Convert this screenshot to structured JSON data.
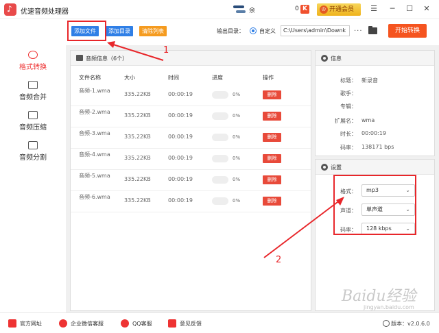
{
  "app": {
    "title": "优速音频处理器",
    "user": "余",
    "coins": "0",
    "coin_badge": "K",
    "vip_label": "开通会员",
    "vip_crown": "♔"
  },
  "window_controls": {
    "menu": "☰",
    "minimize": "─",
    "maximize": "☐",
    "close": "✕"
  },
  "toolbar": {
    "add_file": "添加文件",
    "add_dir": "添加目录",
    "clear_list": "清除列表",
    "output_label": "输出目录：",
    "custom_label": "自定义",
    "path_value": "C:\\Users\\admin\\Downk",
    "more": "···",
    "start": "开始转换"
  },
  "sidebar": {
    "items": [
      {
        "label": "格式转换",
        "icon": "format-convert-icon",
        "active": true
      },
      {
        "label": "音频合并",
        "icon": "merge-icon",
        "active": false
      },
      {
        "label": "音频压缩",
        "icon": "compress-icon",
        "active": false
      },
      {
        "label": "音频分割",
        "icon": "split-icon",
        "active": false
      }
    ]
  },
  "file_panel": {
    "title": "音频信息（6个）",
    "columns": [
      "文件名称",
      "大小",
      "时间",
      "进度",
      "操作"
    ],
    "rows": [
      {
        "name": "音频-1.wma",
        "size": "335.22KB",
        "time": "00:00:19",
        "progress": "0%",
        "action": "删除"
      },
      {
        "name": "音频-2.wma",
        "size": "335.22KB",
        "time": "00:00:19",
        "progress": "0%",
        "action": "删除"
      },
      {
        "name": "音频-3.wma",
        "size": "335.22KB",
        "time": "00:00:19",
        "progress": "0%",
        "action": "删除"
      },
      {
        "name": "音频-4.wma",
        "size": "335.22KB",
        "time": "00:00:19",
        "progress": "0%",
        "action": "删除"
      },
      {
        "name": "音频-5.wma",
        "size": "335.22KB",
        "time": "00:00:19",
        "progress": "0%",
        "action": "删除"
      },
      {
        "name": "音频-6.wma",
        "size": "335.22KB",
        "time": "00:00:19",
        "progress": "0%",
        "action": "删除"
      }
    ]
  },
  "info_panel": {
    "title": "信息",
    "fields": [
      {
        "key": "标题：",
        "value": "新录音"
      },
      {
        "key": "歌手：",
        "value": ""
      },
      {
        "key": "专辑：",
        "value": ""
      },
      {
        "key": "扩展名：",
        "value": "wma"
      },
      {
        "key": "时长：",
        "value": "00:00:19"
      },
      {
        "key": "码率：",
        "value": "138171 bps"
      }
    ]
  },
  "settings_panel": {
    "title": "设置",
    "format_label": "格式：",
    "format_value": "mp3",
    "channel_label": "声道：",
    "channel_value": "单声道",
    "bitrate_label": "码率：",
    "bitrate_value": "128 kbps",
    "chevron": "⌄"
  },
  "annotations": {
    "one": "1",
    "two": "2",
    "color": "#e8262a"
  },
  "footer": {
    "website": "官方网址",
    "wechat": "企业微信客服",
    "qq": "QQ客服",
    "feedback": "意见反馈",
    "version": "版本：v2.0.6.0"
  },
  "watermark": {
    "main": "Baidu经验",
    "sub": "jingyan.baidu.com"
  }
}
